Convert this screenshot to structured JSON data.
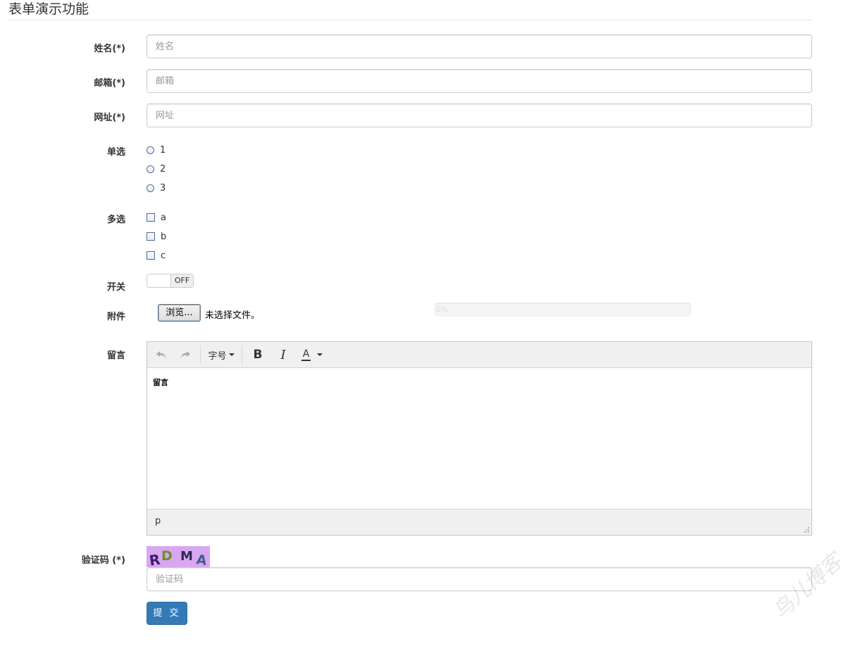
{
  "page": {
    "title": "表单演示功能"
  },
  "form": {
    "name": {
      "label": "姓名(*)",
      "placeholder": "姓名"
    },
    "email": {
      "label": "邮箱(*)",
      "placeholder": "邮箱"
    },
    "url": {
      "label": "网址(*)",
      "placeholder": "网址"
    },
    "radio": {
      "label": "单选",
      "options": [
        "1",
        "2",
        "3"
      ]
    },
    "checkbox": {
      "label": "多选",
      "options": [
        "a",
        "b",
        "c"
      ]
    },
    "switch": {
      "label": "开关",
      "state": "OFF"
    },
    "attachment": {
      "label": "附件",
      "browse_label": "浏览...",
      "status": "未选择文件。",
      "progress_text": "0%",
      "progress": 0
    },
    "message": {
      "label": "留言",
      "toolbar": {
        "font_size_label": "字号",
        "bold": "B",
        "italic": "I",
        "font_color": "A"
      },
      "content": "留言",
      "path": "p"
    },
    "captcha": {
      "label": "验证码 (*)",
      "code": "RDMA",
      "placeholder": "验证码"
    },
    "submit_label": "提 交"
  },
  "watermark": "鸟儿博客",
  "icons": [
    "undo-icon",
    "redo-icon",
    "bold-icon",
    "italic-icon",
    "font-color-icon",
    "resize-grip-icon"
  ]
}
